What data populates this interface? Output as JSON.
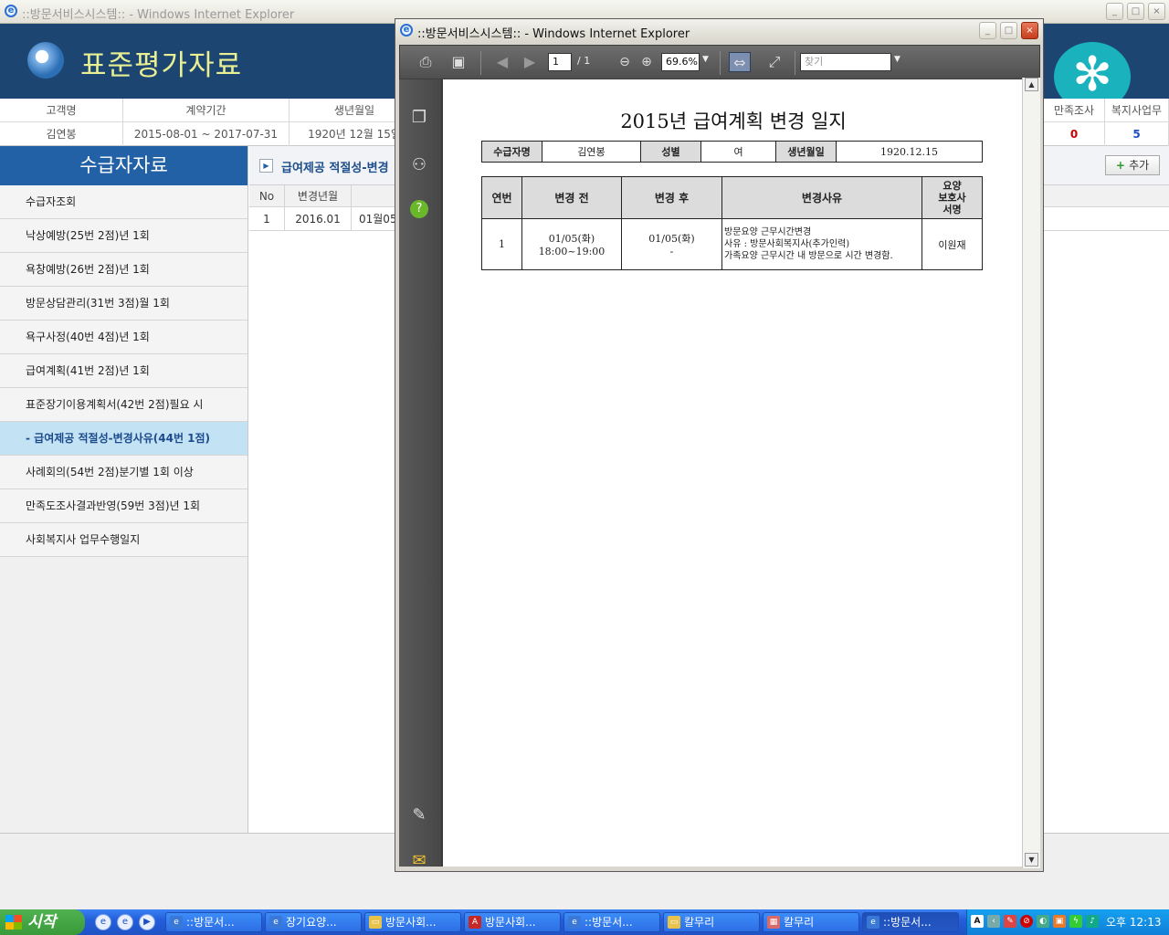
{
  "main_window": {
    "title": "::방문서비스시스템:: - Windows Internet Explorer",
    "banner_title": "표준평가자료",
    "info_headers": [
      "고객명",
      "계약기간",
      "생년월일",
      "만족조사",
      "복지사업무"
    ],
    "info_values": [
      "김연봉",
      "2015-08-01 ~ 2017-07-31",
      "1920년 12월 15일",
      "0",
      "5"
    ]
  },
  "sidebar": {
    "title": "수급자자료",
    "items": [
      {
        "label": "수급자조회"
      },
      {
        "label": "낙상예방(25번 2점)년 1회"
      },
      {
        "label": "욕창예방(26번 2점)년 1회"
      },
      {
        "label": "방문상담관리(31번 3점)월 1회"
      },
      {
        "label": "욕구사정(40번 4점)년 1회"
      },
      {
        "label": "급여계획(41번 2점)년 1회"
      },
      {
        "label": "표준장기이용계획서(42번 2점)필요 시"
      },
      {
        "label": "- 급여제공 적절성-변경사유(44번 1점)"
      },
      {
        "label": "사례회의(54번 2점)분기별 1회 이상"
      },
      {
        "label": "만족도조사결과반영(59번 3점)년 1회"
      },
      {
        "label": "사회복지사 업무수행일지"
      }
    ]
  },
  "content": {
    "title": "급여제공 적절성-변경",
    "add_label": "추가",
    "grid_headers": [
      "No",
      "변경년월"
    ],
    "grid_row": [
      "1",
      "2016.01",
      "01월05일"
    ]
  },
  "popup": {
    "title": "::방문서비스시스템:: - Windows Internet Explorer",
    "toolbar": {
      "page": "1",
      "page_total": "/ 1",
      "zoom": "69.6%",
      "find_placeholder": "찾기"
    },
    "doc": {
      "title": "2015년 급여계획 변경 일지",
      "info": [
        {
          "label": "수급자명",
          "value": "김연봉"
        },
        {
          "label": "성별",
          "value": "여"
        },
        {
          "label": "생년월일",
          "value": "1920.12.15"
        }
      ],
      "headers": [
        "연번",
        "변경 전",
        "변경 후",
        "변경사유",
        "요양\n보호사\n서명"
      ],
      "row": {
        "no": "1",
        "before_1": "01/05(화)",
        "before_2": "18:00~19:00",
        "after_1": "01/05(화)",
        "after_2": "-",
        "reason_1": "방문요양 근무시간변경",
        "reason_2": "사유 : 방문사회복지사(추가인력)",
        "reason_3": "가족요양 근무시간 내 방문으로 시간 변경함.",
        "sign": "이원재"
      }
    }
  },
  "taskbar": {
    "start": "시작",
    "tasks": [
      {
        "label": "::방문서..."
      },
      {
        "label": "장기요양..."
      },
      {
        "label": "방문사회..."
      },
      {
        "label": "방문사회..."
      },
      {
        "label": "::방문서..."
      },
      {
        "label": "칼무리"
      },
      {
        "label": "칼무리"
      },
      {
        "label": "::방문서..."
      }
    ],
    "clock": "오후 12:13"
  },
  "colors": {
    "banner": "#1d4572",
    "sidebar_head": "#2361a6",
    "active_item": "#c3e3f5",
    "accent_teal": "#1ab3bd",
    "red_count": "#cc0000",
    "blue_count": "#1d4fc2"
  }
}
